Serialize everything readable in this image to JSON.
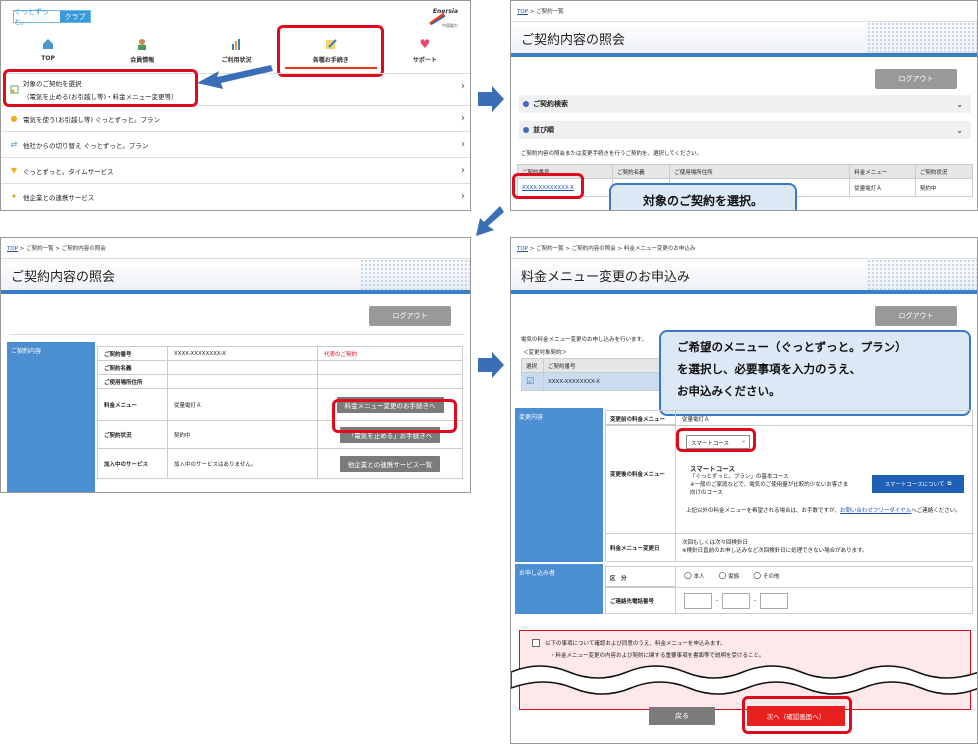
{
  "panel1": {
    "logo_left": "ぐっとずっと。",
    "logo_right": "クラブ",
    "brand": "Enersia",
    "brand_sub": "中国電力",
    "nav": [
      {
        "icon": "home-icon",
        "label": "TOP"
      },
      {
        "icon": "person-icon",
        "label": "会員情報"
      },
      {
        "icon": "bar-chart-icon",
        "label": "ご利用状況"
      },
      {
        "icon": "pencil-icon",
        "label": "各種お手続き"
      },
      {
        "icon": "heart-icon",
        "label": "サポート"
      }
    ],
    "menu": [
      {
        "line1": "対象のご契約を選択",
        "line2": "（電気を止める(お引越し等)・料金メニュー変更等）"
      },
      {
        "label": "電気を使う(お引越し等) ぐっとずっと。プラン"
      },
      {
        "label": "他社からの切り替え ぐっとずっと。プラン"
      },
      {
        "label": "ぐっとずっと。タイムサービス"
      },
      {
        "label": "他企業との連携サービス"
      }
    ]
  },
  "panel2": {
    "crumb_top": "TOP",
    "crumb_rest": " > ご契約一覧",
    "title": "ご契約内容の照会",
    "logout": "ログアウト",
    "acc1": "ご契約検索",
    "acc2": "並び順",
    "note": "ご契約内容の照会または変更手続きを行うご契約を、選択してください。",
    "headers": [
      "ご契約番号",
      "ご契約名義",
      "ご使用場所住所",
      "料金メニュー",
      "ご契約状況"
    ],
    "row": [
      "XXXX-XXXXXXXX-X",
      "",
      "",
      "従量電灯Ａ",
      "契約中"
    ],
    "callout": "対象のご契約を選択。"
  },
  "panel3": {
    "crumb_top": "TOP",
    "crumb_rest": " > ご契約一覧 > ご契約内容の照会",
    "title": "ご契約内容の照会",
    "logout": "ログアウト",
    "sidebar": "ご契約内容",
    "rows": [
      {
        "k": "ご契約番号",
        "v": "XXXX-XXXXXXXX-X",
        "extra": "代表のご契約"
      },
      {
        "k": "ご契約名義",
        "v": ""
      },
      {
        "k": "ご使用場所住所",
        "v": ""
      },
      {
        "k": "料金メニュー",
        "v": "従量電灯Ａ",
        "btn": "料金メニュー変更のお手続きへ"
      },
      {
        "k": "ご契約状況",
        "v": "契約中",
        "btn": "「電気を止める」お手続きへ"
      },
      {
        "k": "加入中のサービス",
        "v": "加入中のサービスはありません。",
        "btn": "他企業との連携サービス一覧"
      }
    ]
  },
  "panel4": {
    "crumb_top": "TOP",
    "crumb_rest": " > ご契約一覧 > ご契約内容の照会 > 料金メニュー変更のお申込み",
    "title": "料金メニュー変更のお申込み",
    "logout": "ログアウト",
    "intro": "電気の料金メニュー変更のお申し込みを行います。",
    "target_label": "＜変更対象契約＞",
    "target_headers": [
      "選択",
      "ご契約番号"
    ],
    "target_value": "XXXX-XXXXXXXX-X",
    "callout_lines": [
      "ご希望のメニュー（ぐっとずっと。プラン）",
      "を選択し、必要事項を入力のうえ、",
      "お申込みください。"
    ],
    "section1": "変更内容",
    "before_label": "変更前の料金メニュー",
    "before_value": "従量電灯Ａ",
    "after_label": "変更後の料金メニュー",
    "select_value": "スマートコース",
    "smart_title": "スマートコース",
    "smart_desc1": "「ぐっとずっと。プラン」の基本コース",
    "smart_desc2": "※一般のご家庭などで、電気のご使用量が比較的少ないお客さま",
    "smart_desc3": "向けのコース",
    "smart_btn": "スマートコースについて",
    "other_note1": "上記以外の料金メニューを希望される場合は、お手数ですが、",
    "other_link": "お問い合わせフリーダイヤル",
    "other_note2": "へご連絡ください。",
    "change_date_label": "料金メニュー変更日",
    "change_date1": "次回もしくは次々回検針日",
    "change_date2": "※検針日直前のお申し込みなど次回検針日に処理できない場合があります。",
    "section2": "お申し込み者",
    "kubun_label": "区　分",
    "radios": [
      "本人",
      "家族",
      "その他"
    ],
    "phone_label": "ご連絡先電話番号",
    "agree1": "以下の事項について確認および同意のうえ、料金メニューを申込みます。",
    "agree2": "・料金メニュー変更の内容および契約に関する重要事項を書面等で説明を受けること。",
    "back": "戻る",
    "next": "次へ（確認画面へ）"
  },
  "colors": {
    "accent": "#3a7ec3",
    "red": "#e00a1e",
    "sidebar": "#4b8ed2"
  }
}
